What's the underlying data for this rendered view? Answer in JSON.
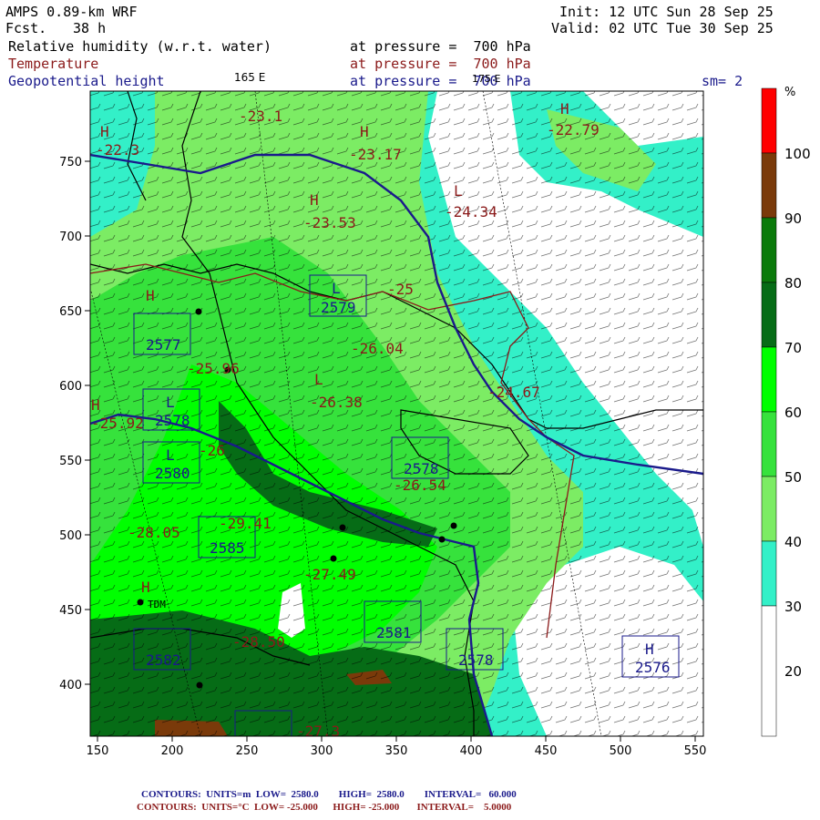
{
  "header": {
    "model": "AMPS 0.89-km WRF",
    "forecast_label": "Fcst.",
    "forecast_value": "38 h",
    "init": "Init: 12 UTC Sun 28 Sep 25",
    "valid": "Valid: 02 UTC Tue 30 Sep 25",
    "field1_name": "Relative humidity (w.r.t. water)",
    "field1_level": "at pressure =  700 hPa",
    "field2_name": "Temperature",
    "field2_level": "at pressure =  700 hPa",
    "field3_name": "Geopotential height",
    "field3_level": "at pressure =  700 hPa",
    "smoothing": "sm= 2",
    "lon_label_165": "165 E",
    "lon_label_175": "175 E"
  },
  "colors": {
    "c_20_30": "#ffffff",
    "c_30_40": "#33f0c8",
    "c_40_50": "#7cec64",
    "c_50_60": "#36e23c",
    "c_60_70": "#00ff00",
    "c_70_80": "#066c16",
    "c_80_90": "#0a7a0a",
    "c_90_100": "#7a3a0a",
    "c_100": "#ff0000",
    "temp_contour": "#8b1a1a",
    "height_contour": "#1a1a8b"
  },
  "colorbar": {
    "unit": "%",
    "ticks": [
      "100",
      "90",
      "80",
      "70",
      "60",
      "50",
      "40",
      "30",
      "20"
    ]
  },
  "axes": {
    "x_ticks": [
      "150",
      "200",
      "250",
      "300",
      "350",
      "400",
      "450",
      "500",
      "550"
    ],
    "y_ticks": [
      "750",
      "700",
      "650",
      "600",
      "550",
      "500",
      "450",
      "400"
    ]
  },
  "labels": {
    "temps": [
      "-22.3",
      "-23.1",
      "-23.17",
      "-22.79",
      "-23.53",
      "-24.34",
      "-25",
      "-26.04",
      "-24.67",
      "-25.96",
      "-26.38",
      "-25.92",
      "-26",
      "-26.54",
      "-28.05",
      "-29.41",
      "-27.49",
      "-28.50",
      "-27.3"
    ],
    "heights": [
      "2579",
      "2577",
      "2578",
      "2580",
      "2578",
      "2585",
      "2581",
      "2578",
      "2582",
      "2576"
    ],
    "highs_lows": [
      "H",
      "L"
    ],
    "station": "TDM"
  },
  "footer": {
    "height_line": "CONTOURS:  UNITS=m  LOW=  2580.0        HIGH=  2580.0        INTERVAL=   60.000",
    "temp_line": "CONTOURS:  UNITS=°C  LOW= -25.000      HIGH= -25.000       INTERVAL=    5.0000"
  }
}
